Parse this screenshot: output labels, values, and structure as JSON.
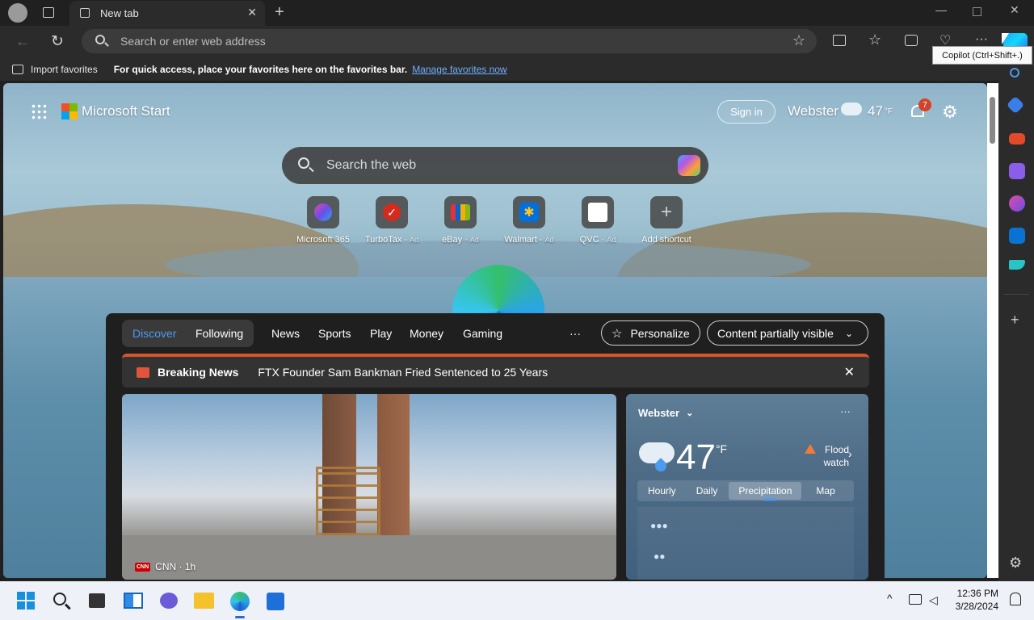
{
  "browser": {
    "tab_title": "New tab",
    "address_placeholder": "Search or enter web address",
    "favorites_import": "Import favorites",
    "favorites_hint": "For quick access, place your favorites here on the favorites bar.",
    "favorites_manage_link": "Manage favorites now",
    "tooltip": "Copilot (Ctrl+Shift+.)"
  },
  "start": {
    "brand": "Microsoft Start",
    "sign_in": "Sign in",
    "location": "Webster",
    "temp": "47",
    "temp_unit": "°F",
    "notifications_count": "7",
    "search_placeholder": "Search the web",
    "shortcuts": [
      {
        "label": "Microsoft 365",
        "ad": ""
      },
      {
        "label": "TurboTax",
        "ad": "Ad"
      },
      {
        "label": "eBay",
        "ad": "Ad"
      },
      {
        "label": "Walmart",
        "ad": "Ad"
      },
      {
        "label": "QVC",
        "ad": "Ad"
      },
      {
        "label": "Add shortcut",
        "ad": ""
      }
    ]
  },
  "feed": {
    "tabs": {
      "discover": "Discover",
      "following": "Following"
    },
    "nav": [
      "News",
      "Sports",
      "Play",
      "Money",
      "Gaming"
    ],
    "more": "···",
    "personalize": "Personalize",
    "content_visibility": "Content partially visible",
    "breaking_label": "Breaking News",
    "breaking_headline": "FTX Founder Sam Bankman Fried Sentenced to 25 Years",
    "article_source": "CNN · 1h",
    "article_source_logo": "CNN"
  },
  "weather": {
    "location": "Webster",
    "temp": "47",
    "unit": "°F",
    "alert": "Flood watch",
    "more": "···",
    "tabs": [
      "Hourly",
      "Daily",
      "Precipitation",
      "Map"
    ],
    "active_tab": "Precipitation"
  },
  "taskbar": {
    "time": "12:36 PM",
    "date": "3/28/2024"
  },
  "colors": {
    "accent_blue": "#4c9bf0",
    "breaking_red": "#d4552e",
    "badge_red": "#d4422a"
  }
}
